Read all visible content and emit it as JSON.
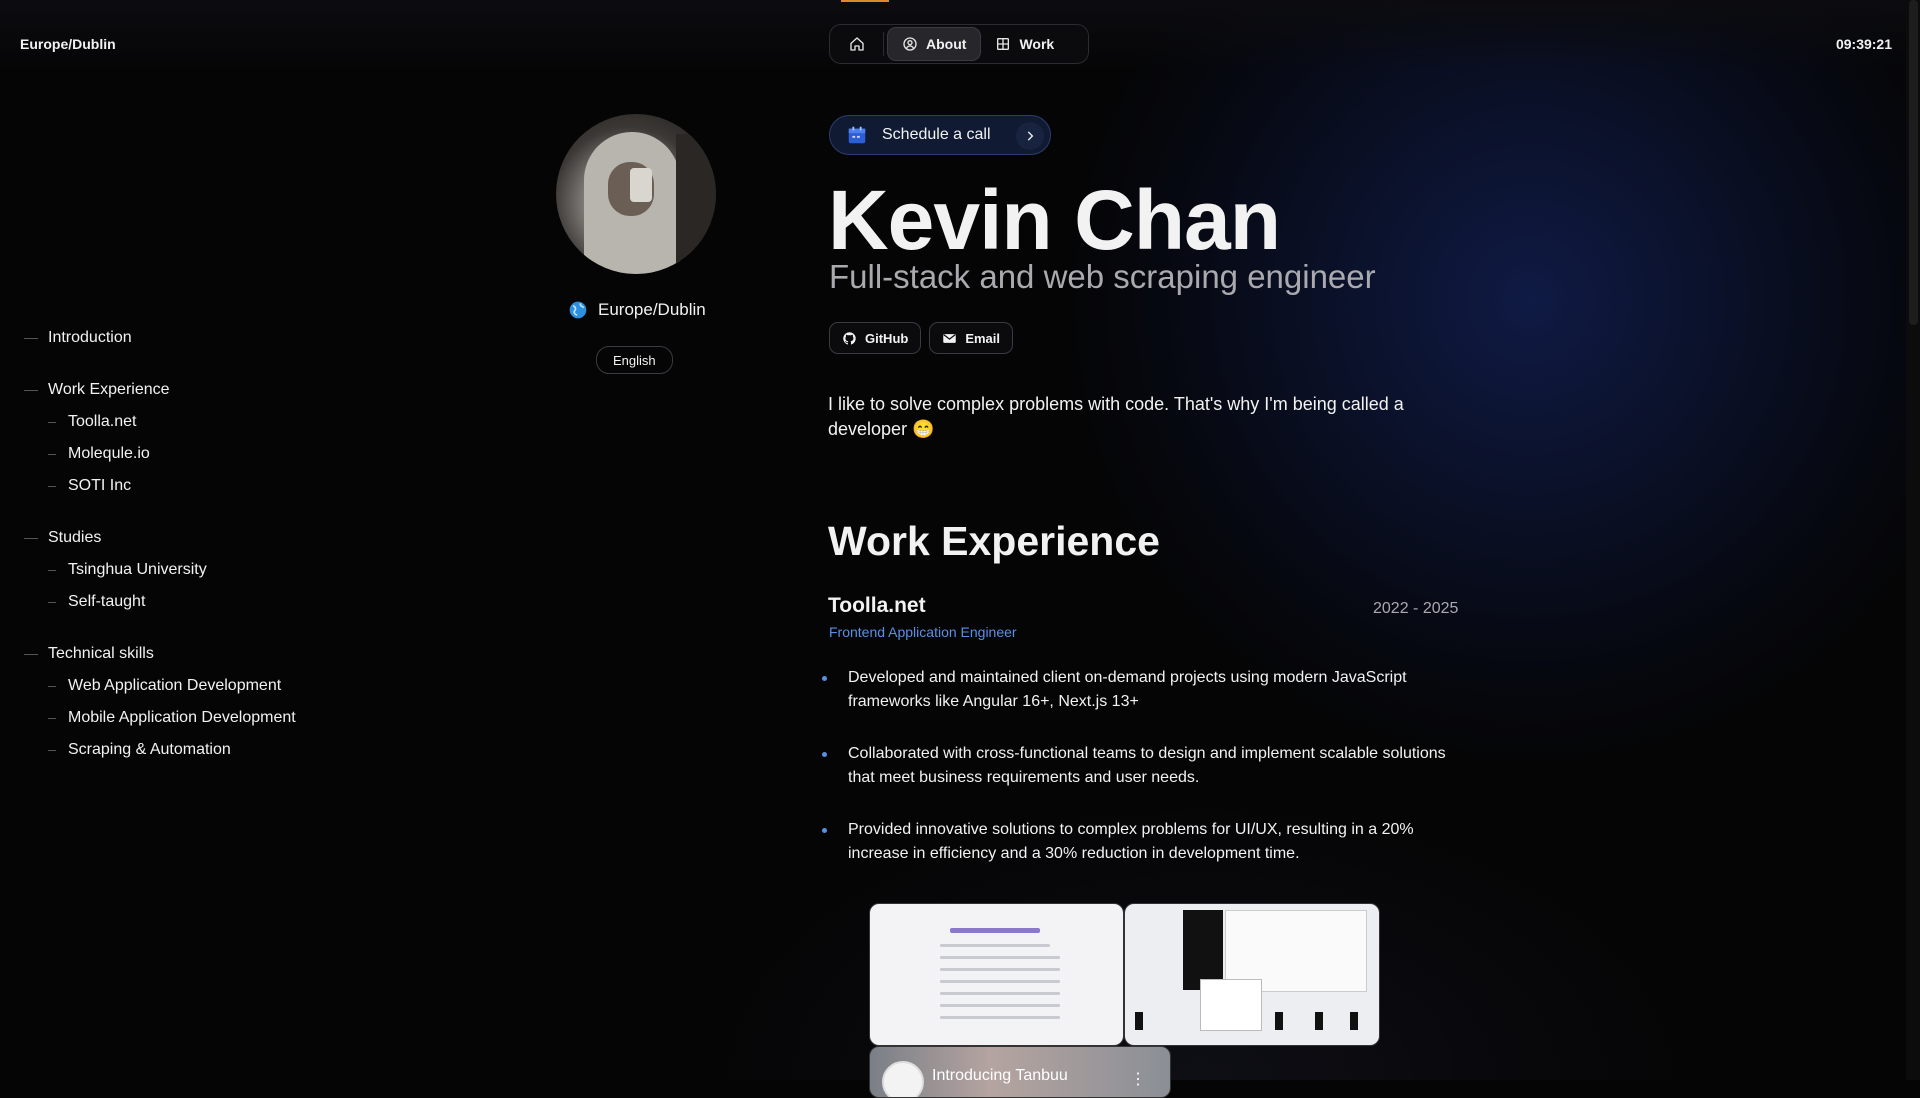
{
  "header": {
    "timezone": "Europe/Dublin",
    "time": "09:39:21",
    "nav": {
      "about": "About",
      "work": "Work"
    }
  },
  "profile": {
    "location": "Europe/Dublin",
    "language": "English"
  },
  "toc": {
    "sections": [
      {
        "label": "Introduction",
        "items": []
      },
      {
        "label": "Work Experience",
        "items": [
          "Toolla.net",
          "Molequle.io",
          "SOTI Inc"
        ]
      },
      {
        "label": "Studies",
        "items": [
          "Tsinghua University",
          "Self-taught"
        ]
      },
      {
        "label": "Technical skills",
        "items": [
          "Web Application Development",
          "Mobile Application Development",
          "Scraping & Automation"
        ]
      }
    ]
  },
  "hero": {
    "schedule_label": "Schedule a call",
    "name": "Kevin Chan",
    "role": "Full-stack and web scraping engineer",
    "github_label": "GitHub",
    "email_label": "Email",
    "intro": "I like to solve complex problems with code. That's why I'm being called a developer 😁"
  },
  "work": {
    "heading": "Work Experience",
    "jobs": [
      {
        "company": "Toolla.net",
        "dates": "2022 - 2025",
        "role": "Frontend Application Engineer",
        "bullets": [
          "Developed and maintained client on-demand projects using modern JavaScript frameworks like Angular 16+, Next.js 13+",
          "Collaborated with cross-functional teams to design and implement scalable solutions that meet business requirements and user needs.",
          "Provided innovative solutions to complex problems for UI/UX, resulting in a 20% increase in efficiency and a 30% reduction in development time."
        ]
      }
    ],
    "video_title": "Introducing Tanbuu"
  },
  "colors": {
    "accent_blue": "#5a8fe6",
    "accent_orange": "#d98a2b",
    "background": "#050506"
  }
}
